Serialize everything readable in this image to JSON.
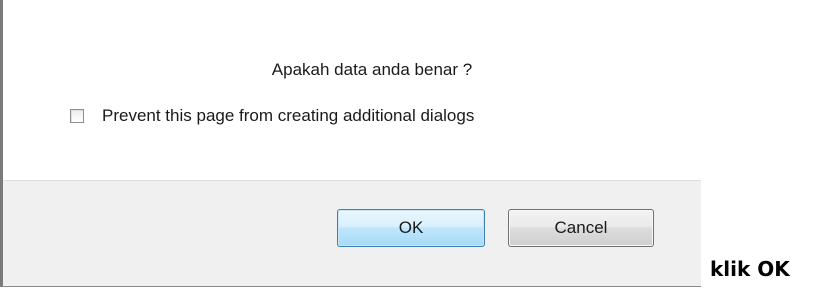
{
  "dialog": {
    "message": "Apakah data anda benar ?",
    "checkbox_label": "Prevent this page from creating additional dialogs",
    "checkbox_checked": false,
    "ok_label": "OK",
    "cancel_label": "Cancel"
  },
  "annotation": {
    "text": "klik OK"
  }
}
